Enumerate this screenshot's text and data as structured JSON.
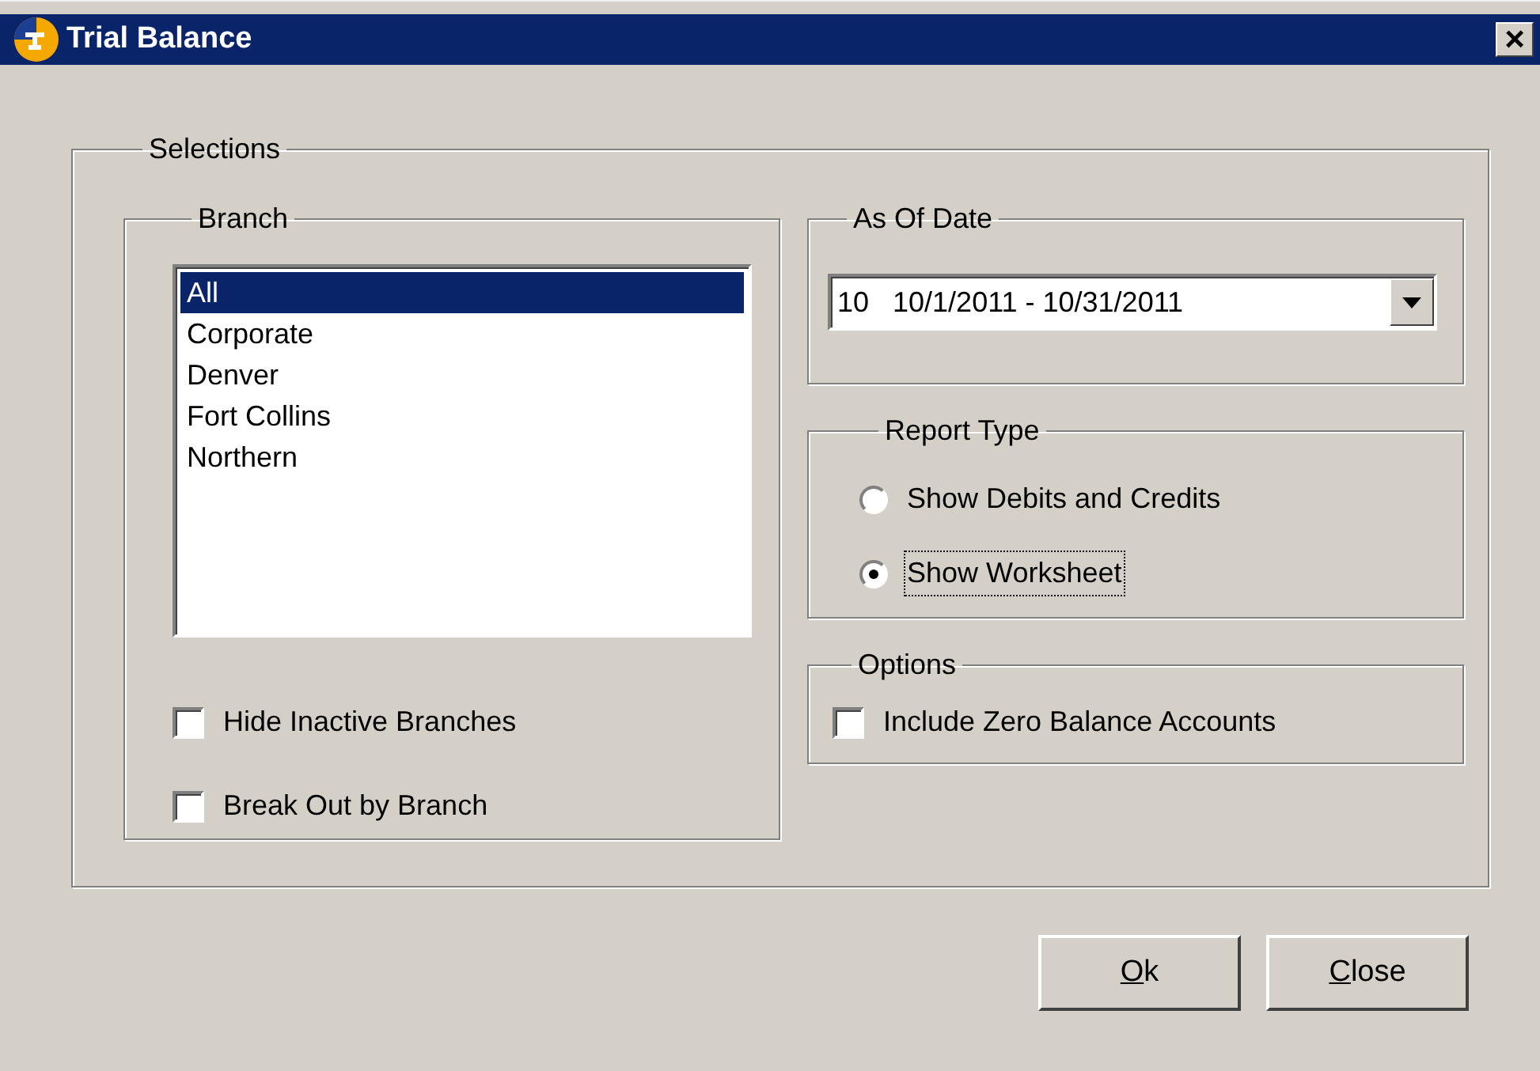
{
  "window": {
    "title": "Trial Balance",
    "close_glyph": "×"
  },
  "selections": {
    "title": "Selections"
  },
  "branch": {
    "title": "Branch",
    "items": [
      {
        "label": "All",
        "selected": true
      },
      {
        "label": "Corporate",
        "selected": false
      },
      {
        "label": "Denver",
        "selected": false
      },
      {
        "label": "Fort Collins",
        "selected": false
      },
      {
        "label": "Northern",
        "selected": false
      }
    ],
    "checkboxes": [
      {
        "label": "Hide Inactive Branches",
        "checked": false
      },
      {
        "label": "Break Out by Branch",
        "checked": false
      }
    ]
  },
  "as_of_date": {
    "title": "As Of Date",
    "value": "10   10/1/2011 - 10/31/2011"
  },
  "report_type": {
    "title": "Report Type",
    "options": [
      {
        "label": "Show Debits and Credits",
        "selected": false,
        "focused": false
      },
      {
        "label": "Show Worksheet",
        "selected": true,
        "focused": true
      }
    ]
  },
  "options": {
    "title": "Options",
    "checkboxes": [
      {
        "label": "Include Zero Balance Accounts",
        "checked": false
      }
    ]
  },
  "buttons": [
    {
      "label": "Ok"
    },
    {
      "label": "Close"
    }
  ]
}
